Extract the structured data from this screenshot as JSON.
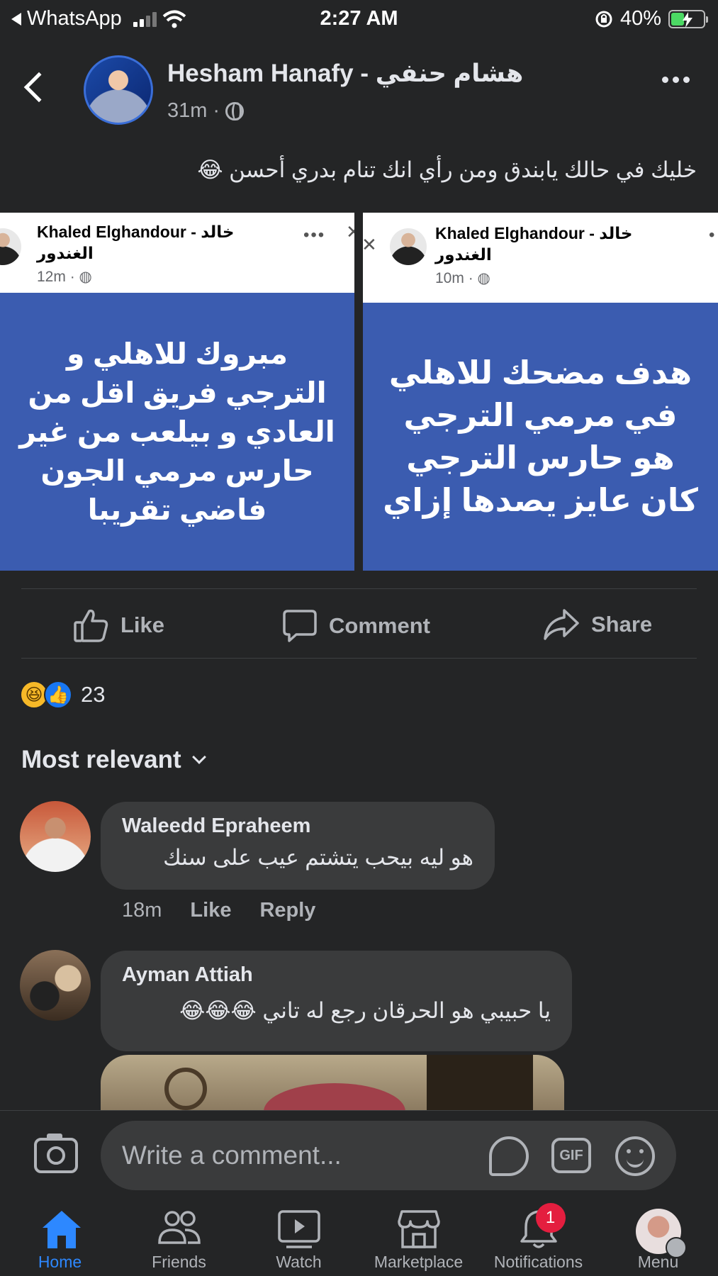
{
  "status_bar": {
    "back_app": "WhatsApp",
    "time": "2:27 AM",
    "battery": "40%",
    "battery_level": 0.4
  },
  "post": {
    "author": "Hesham Hanafy - هشام حنفي",
    "time": "31m",
    "privacy_icon": "globe-icon",
    "text": "خليك في حالك يابندق ومن رأي انك تنام بدري أحسن 😂",
    "images": [
      {
        "author": "Khaled Elghandour - خالد الغندور",
        "time": "12m",
        "text": "مبروك للاهلي و الترجي فريق اقل من العادي و بيلعب من غير حارس مرمي الجون فاضي تقريبا"
      },
      {
        "author": "Khaled Elghandour - خالد الغندور",
        "time": "10m",
        "text": "هدف مضحك للاهلي في مرمي الترجي هو حارس الترجي كان عايز يصدها إزاي"
      }
    ]
  },
  "actions": {
    "like": "Like",
    "comment": "Comment",
    "share": "Share"
  },
  "reactions": {
    "count": "23",
    "emoji_haha": "😆",
    "emoji_like": "👍"
  },
  "sort": {
    "label": "Most relevant"
  },
  "comments": [
    {
      "name": "Waleedd Epraheem",
      "text": "هو ليه بيحب يتشتم عيب على سنك",
      "time": "18m",
      "like": "Like",
      "reply": "Reply"
    },
    {
      "name": "Ayman Attiah",
      "text": "يا حبيبي هو الحرقان رجع له تاني 😂😂😂"
    }
  ],
  "composer": {
    "placeholder": "Write a comment...",
    "gif": "GIF"
  },
  "tabs": [
    {
      "label": "Home",
      "icon": "home-icon"
    },
    {
      "label": "Friends",
      "icon": "friends-icon"
    },
    {
      "label": "Watch",
      "icon": "watch-icon"
    },
    {
      "label": "Marketplace",
      "icon": "marketplace-icon"
    },
    {
      "label": "Notifications",
      "icon": "bell-icon",
      "badge": "1"
    },
    {
      "label": "Menu",
      "icon": "menu-avatar"
    }
  ],
  "colors": {
    "background": "#242526",
    "accent": "#2d88ff",
    "image_blue": "#3b5cb0",
    "badge": "#e41e3f"
  }
}
